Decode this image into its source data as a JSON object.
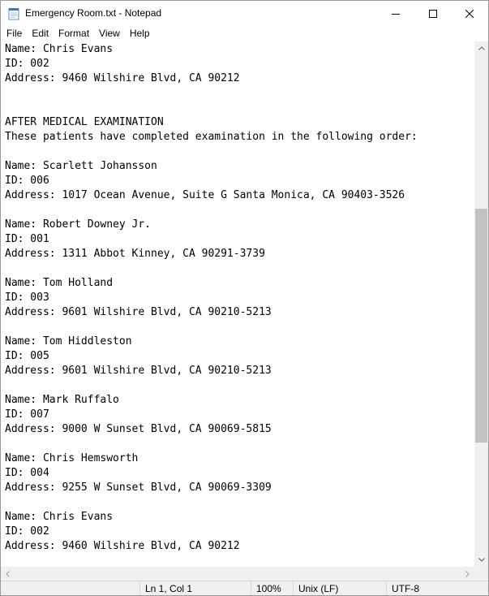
{
  "window": {
    "title": "Emergency Room.txt - Notepad",
    "app_icon": "notepad-icon",
    "controls": [
      "minimize-icon",
      "maximize-icon",
      "close-icon"
    ]
  },
  "menu": [
    "File",
    "Edit",
    "Format",
    "View",
    "Help"
  ],
  "editor": {
    "lines": [
      "Name: Chris Evans",
      "ID: 002",
      "Address: 9460 Wilshire Blvd, CA 90212",
      "",
      "",
      "AFTER MEDICAL EXAMINATION",
      "These patients have completed examination in the following order:",
      "",
      "Name: Scarlett Johansson",
      "ID: 006",
      "Address: 1017 Ocean Avenue, Suite G Santa Monica, CA 90403-3526",
      "",
      "Name: Robert Downey Jr.",
      "ID: 001",
      "Address: 1311 Abbot Kinney, CA 90291-3739",
      "",
      "Name: Tom Holland",
      "ID: 003",
      "Address: 9601 Wilshire Blvd, CA 90210-5213",
      "",
      "Name: Tom Hiddleston",
      "ID: 005",
      "Address: 9601 Wilshire Blvd, CA 90210-5213",
      "",
      "Name: Mark Ruffalo",
      "ID: 007",
      "Address: 9000 W Sunset Blvd, CA 90069-5815",
      "",
      "Name: Chris Hemsworth",
      "ID: 004",
      "Address: 9255 W Sunset Blvd, CA 90069-3309",
      "",
      "Name: Chris Evans",
      "ID: 002",
      "Address: 9460 Wilshire Blvd, CA 90212"
    ]
  },
  "scrollbar": {
    "vertical_position": 0.58,
    "vertical_visible_fraction": 0.47
  },
  "status": {
    "position": "Ln 1, Col 1",
    "zoom": "100%",
    "line_ending": "Unix (LF)",
    "encoding": "UTF-8"
  }
}
